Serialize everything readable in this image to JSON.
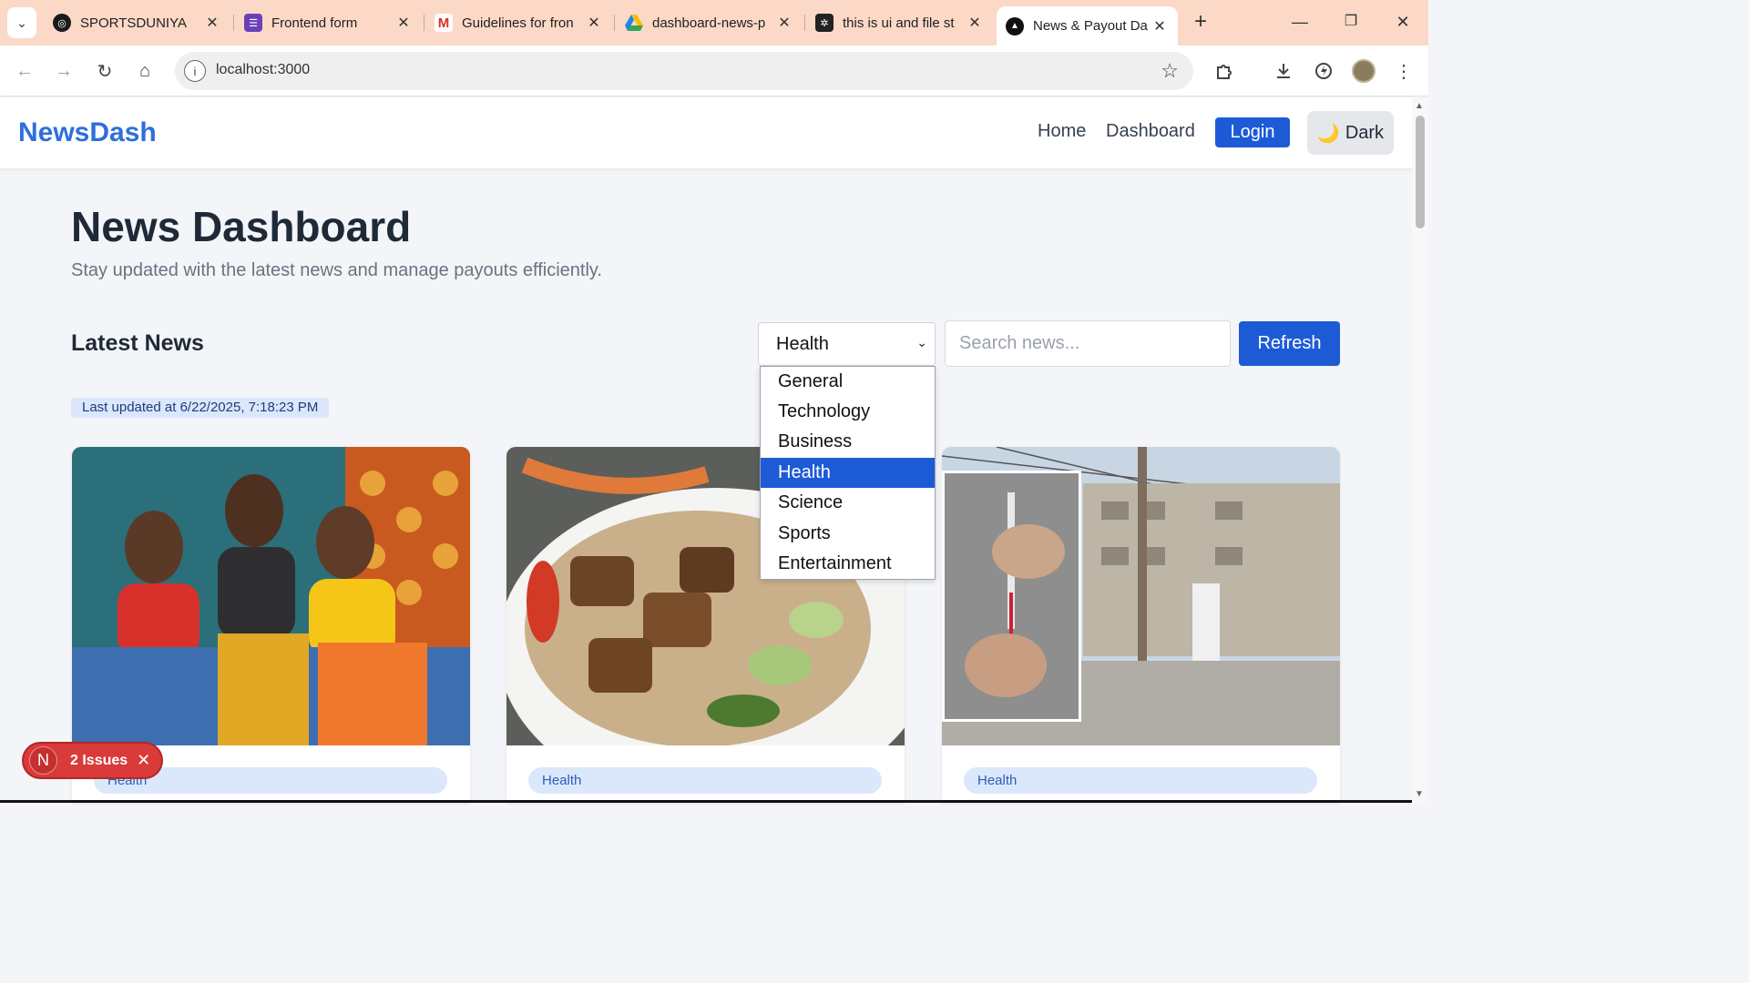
{
  "browser": {
    "tabs": [
      {
        "title": "SPORTSDUNIYA",
        "icon": "sportsduniya-icon",
        "color": "#1a1a1a"
      },
      {
        "title": "Frontend form",
        "icon": "forms-icon",
        "color": "#6b3fb8"
      },
      {
        "title": "Guidelines for fron",
        "icon": "gmail-icon",
        "color": "#d93025"
      },
      {
        "title": "dashboard-news-p",
        "icon": "drive-icon",
        "color": "#1e88e5"
      },
      {
        "title": "this is ui and file st",
        "icon": "chatgpt-icon",
        "color": "#222222"
      },
      {
        "title": "News & Payout Da",
        "icon": "nextjs-icon",
        "color": "#111111"
      }
    ],
    "url": "localhost:3000"
  },
  "app": {
    "logo": "NewsDash",
    "nav": {
      "home": "Home",
      "dashboard": "Dashboard",
      "login": "Login",
      "theme": "Dark"
    },
    "title": "News Dashboard",
    "subtitle": "Stay updated with the latest news and manage payouts efficiently.",
    "section_title": "Latest News",
    "category_selected": "Health",
    "category_options": [
      "General",
      "Technology",
      "Business",
      "Health",
      "Science",
      "Sports",
      "Entertainment"
    ],
    "search_placeholder": "Search news...",
    "refresh": "Refresh",
    "last_updated": "Last updated at 6/22/2025, 7:18:23 PM",
    "cards": [
      {
        "tag": "Health"
      },
      {
        "tag": "Health"
      },
      {
        "tag": "Health"
      }
    ]
  },
  "dev_overlay": {
    "badge_letter": "N",
    "issues": "2 Issues"
  },
  "colors": {
    "accent": "#1d5bd6",
    "logo": "#2e6fdc",
    "tabbar": "#fcd9c7",
    "issues": "#d93a3a"
  }
}
